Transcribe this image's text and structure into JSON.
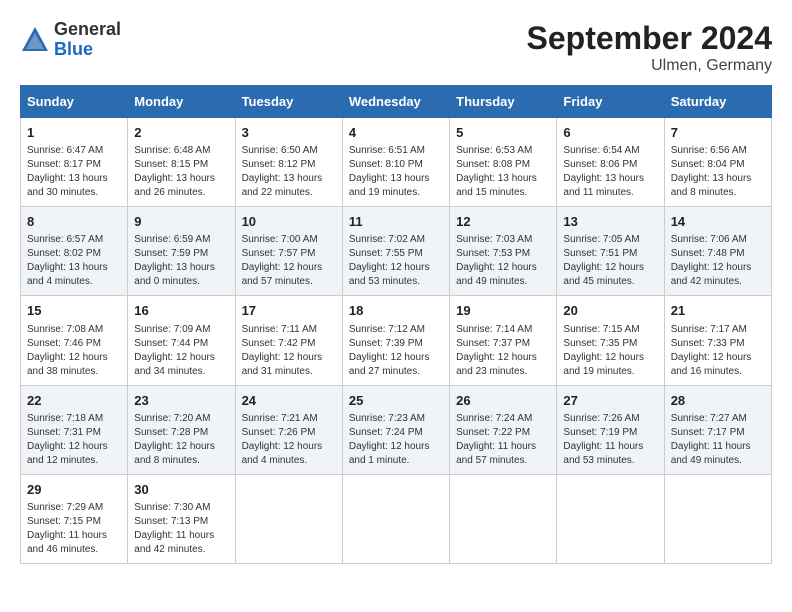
{
  "logo": {
    "line1": "General",
    "line2": "Blue"
  },
  "title": "September 2024",
  "subtitle": "Ulmen, Germany",
  "days_of_week": [
    "Sunday",
    "Monday",
    "Tuesday",
    "Wednesday",
    "Thursday",
    "Friday",
    "Saturday"
  ],
  "rows": [
    [
      {
        "day": "1",
        "info": "Sunrise: 6:47 AM\nSunset: 8:17 PM\nDaylight: 13 hours\nand 30 minutes."
      },
      {
        "day": "2",
        "info": "Sunrise: 6:48 AM\nSunset: 8:15 PM\nDaylight: 13 hours\nand 26 minutes."
      },
      {
        "day": "3",
        "info": "Sunrise: 6:50 AM\nSunset: 8:12 PM\nDaylight: 13 hours\nand 22 minutes."
      },
      {
        "day": "4",
        "info": "Sunrise: 6:51 AM\nSunset: 8:10 PM\nDaylight: 13 hours\nand 19 minutes."
      },
      {
        "day": "5",
        "info": "Sunrise: 6:53 AM\nSunset: 8:08 PM\nDaylight: 13 hours\nand 15 minutes."
      },
      {
        "day": "6",
        "info": "Sunrise: 6:54 AM\nSunset: 8:06 PM\nDaylight: 13 hours\nand 11 minutes."
      },
      {
        "day": "7",
        "info": "Sunrise: 6:56 AM\nSunset: 8:04 PM\nDaylight: 13 hours\nand 8 minutes."
      }
    ],
    [
      {
        "day": "8",
        "info": "Sunrise: 6:57 AM\nSunset: 8:02 PM\nDaylight: 13 hours\nand 4 minutes."
      },
      {
        "day": "9",
        "info": "Sunrise: 6:59 AM\nSunset: 7:59 PM\nDaylight: 13 hours\nand 0 minutes."
      },
      {
        "day": "10",
        "info": "Sunrise: 7:00 AM\nSunset: 7:57 PM\nDaylight: 12 hours\nand 57 minutes."
      },
      {
        "day": "11",
        "info": "Sunrise: 7:02 AM\nSunset: 7:55 PM\nDaylight: 12 hours\nand 53 minutes."
      },
      {
        "day": "12",
        "info": "Sunrise: 7:03 AM\nSunset: 7:53 PM\nDaylight: 12 hours\nand 49 minutes."
      },
      {
        "day": "13",
        "info": "Sunrise: 7:05 AM\nSunset: 7:51 PM\nDaylight: 12 hours\nand 45 minutes."
      },
      {
        "day": "14",
        "info": "Sunrise: 7:06 AM\nSunset: 7:48 PM\nDaylight: 12 hours\nand 42 minutes."
      }
    ],
    [
      {
        "day": "15",
        "info": "Sunrise: 7:08 AM\nSunset: 7:46 PM\nDaylight: 12 hours\nand 38 minutes."
      },
      {
        "day": "16",
        "info": "Sunrise: 7:09 AM\nSunset: 7:44 PM\nDaylight: 12 hours\nand 34 minutes."
      },
      {
        "day": "17",
        "info": "Sunrise: 7:11 AM\nSunset: 7:42 PM\nDaylight: 12 hours\nand 31 minutes."
      },
      {
        "day": "18",
        "info": "Sunrise: 7:12 AM\nSunset: 7:39 PM\nDaylight: 12 hours\nand 27 minutes."
      },
      {
        "day": "19",
        "info": "Sunrise: 7:14 AM\nSunset: 7:37 PM\nDaylight: 12 hours\nand 23 minutes."
      },
      {
        "day": "20",
        "info": "Sunrise: 7:15 AM\nSunset: 7:35 PM\nDaylight: 12 hours\nand 19 minutes."
      },
      {
        "day": "21",
        "info": "Sunrise: 7:17 AM\nSunset: 7:33 PM\nDaylight: 12 hours\nand 16 minutes."
      }
    ],
    [
      {
        "day": "22",
        "info": "Sunrise: 7:18 AM\nSunset: 7:31 PM\nDaylight: 12 hours\nand 12 minutes."
      },
      {
        "day": "23",
        "info": "Sunrise: 7:20 AM\nSunset: 7:28 PM\nDaylight: 12 hours\nand 8 minutes."
      },
      {
        "day": "24",
        "info": "Sunrise: 7:21 AM\nSunset: 7:26 PM\nDaylight: 12 hours\nand 4 minutes."
      },
      {
        "day": "25",
        "info": "Sunrise: 7:23 AM\nSunset: 7:24 PM\nDaylight: 12 hours\nand 1 minute."
      },
      {
        "day": "26",
        "info": "Sunrise: 7:24 AM\nSunset: 7:22 PM\nDaylight: 11 hours\nand 57 minutes."
      },
      {
        "day": "27",
        "info": "Sunrise: 7:26 AM\nSunset: 7:19 PM\nDaylight: 11 hours\nand 53 minutes."
      },
      {
        "day": "28",
        "info": "Sunrise: 7:27 AM\nSunset: 7:17 PM\nDaylight: 11 hours\nand 49 minutes."
      }
    ],
    [
      {
        "day": "29",
        "info": "Sunrise: 7:29 AM\nSunset: 7:15 PM\nDaylight: 11 hours\nand 46 minutes."
      },
      {
        "day": "30",
        "info": "Sunrise: 7:30 AM\nSunset: 7:13 PM\nDaylight: 11 hours\nand 42 minutes."
      },
      {
        "day": "",
        "info": ""
      },
      {
        "day": "",
        "info": ""
      },
      {
        "day": "",
        "info": ""
      },
      {
        "day": "",
        "info": ""
      },
      {
        "day": "",
        "info": ""
      }
    ]
  ]
}
